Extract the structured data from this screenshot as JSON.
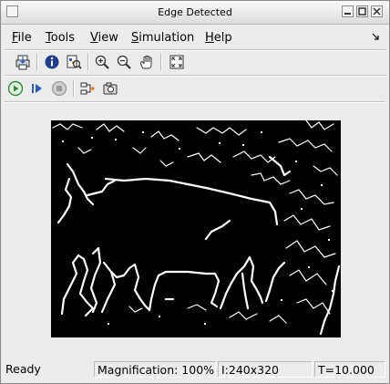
{
  "window": {
    "title": "Edge Detected"
  },
  "menubar": {
    "items": [
      {
        "label": "File",
        "mnemonic": "F",
        "rest": "ile"
      },
      {
        "label": "Tools",
        "mnemonic": "T",
        "rest": "ools"
      },
      {
        "label": "View",
        "mnemonic": "V",
        "rest": "iew"
      },
      {
        "label": "Simulation",
        "mnemonic": "S",
        "rest": "imulation"
      },
      {
        "label": "Help",
        "mnemonic": "H",
        "rest": "elp"
      }
    ]
  },
  "toolbar1": {
    "icons": [
      "print-icon",
      "info-icon",
      "pixel-region-icon",
      "zoom-in-icon",
      "zoom-out-icon",
      "pan-hand-icon",
      "fit-to-window-icon"
    ]
  },
  "toolbar2": {
    "icons": [
      "play-icon",
      "step-forward-icon",
      "stop-icon",
      "export-icon",
      "snapshot-camera-icon"
    ]
  },
  "status": {
    "state": "Ready",
    "magnification": "Magnification: 100%",
    "image_info": "I:240x320",
    "time": "T=10.000"
  },
  "colors": {
    "background": "#ececec",
    "image_bg": "#000000",
    "edge": "#ffffff",
    "play_green": "#2e8b2e",
    "stop_gray": "#9a9a9a"
  }
}
